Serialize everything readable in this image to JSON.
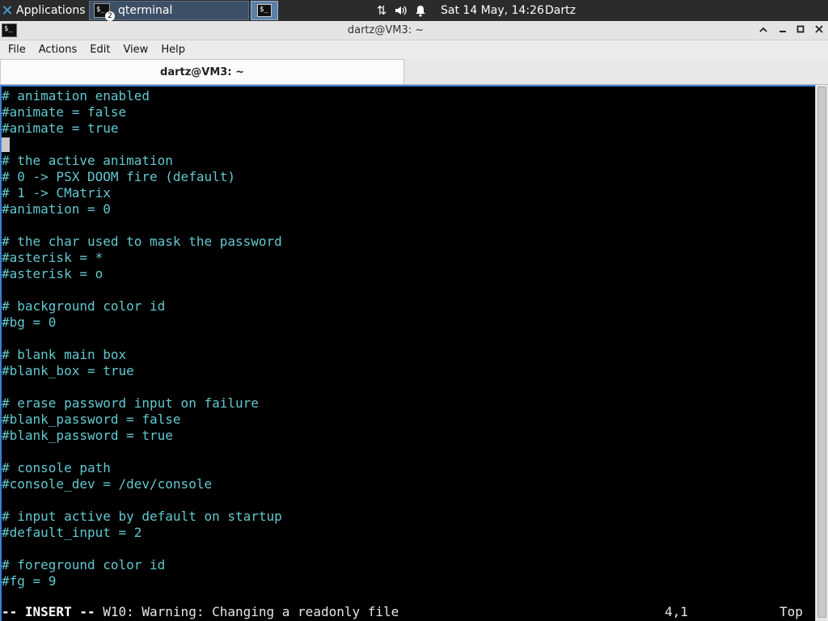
{
  "panel": {
    "apps_label": "Applications",
    "task_label": "qterminal",
    "task_badge": "2",
    "clock": "Sat 14 May, 14:26",
    "user": "Dartz",
    "tray_icons": [
      "network-icon",
      "volume-icon",
      "notification-bell-icon"
    ]
  },
  "window": {
    "title": "dartz@VM3: ~",
    "buttons": [
      "restore-up",
      "minimize",
      "maximize",
      "close"
    ]
  },
  "menubar": [
    "File",
    "Actions",
    "Edit",
    "View",
    "Help"
  ],
  "tab": {
    "label": "dartz@VM3: ~"
  },
  "terminal": {
    "lines": [
      "# animation enabled",
      "#animate = false",
      "#animate = true",
      "",
      "# the active animation",
      "# 0 -> PSX DOOM fire (default)",
      "# 1 -> CMatrix",
      "#animation = 0",
      "",
      "# the char used to mask the password",
      "#asterisk = *",
      "#asterisk = o",
      "",
      "# background color id",
      "#bg = 0",
      "",
      "# blank main box",
      "#blank_box = true",
      "",
      "# erase password input on failure",
      "#blank_password = false",
      "#blank_password = true",
      "",
      "# console path",
      "#console_dev = /dev/console",
      "",
      "# input active by default on startup",
      "#default_input = 2",
      "",
      "# foreground color id",
      "#fg = 9"
    ],
    "cursor_line": 4,
    "status": {
      "mode": "-- INSERT --",
      "message": " W10: Warning: Changing a readonly file",
      "position": "4,1",
      "scroll": "Top"
    }
  },
  "colors": {
    "comment_text": "#63c7cf",
    "terminal_bg": "#000000",
    "panel_bg": "#2b2b2b",
    "focus_border": "#3d7fd6"
  }
}
